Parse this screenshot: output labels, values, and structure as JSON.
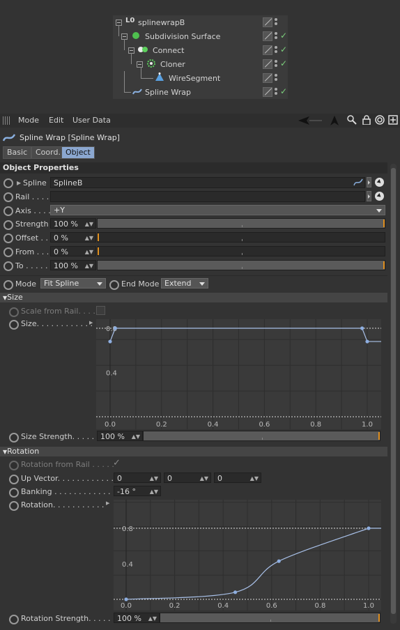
{
  "object_manager": {
    "objects": [
      {
        "name": "splinewrapB",
        "check": false
      },
      {
        "name": "Subdivision Surface",
        "check": true
      },
      {
        "name": "Connect",
        "check": true
      },
      {
        "name": "Cloner",
        "check": true
      },
      {
        "name": "WireSegment",
        "check": false
      },
      {
        "name": "Spline Wrap",
        "check": true
      }
    ]
  },
  "menubar": {
    "mode": "Mode",
    "edit": "Edit",
    "user_data": "User Data"
  },
  "title": "Spline Wrap [Spline Wrap]",
  "tabs": {
    "basic": "Basic",
    "coord": "Coord.",
    "object": "Object"
  },
  "object_properties": {
    "header": "Object Properties",
    "spline": {
      "label": "Spline",
      "value": "SplineB"
    },
    "rail": {
      "label": "Rail . . . .",
      "value": ""
    },
    "axis": {
      "label": "Axis . . . .",
      "value": "+Y"
    },
    "strength": {
      "label": "Strength",
      "value": "100 %",
      "level": 1.0
    },
    "offset": {
      "label": "Offset . .",
      "value": "0 %",
      "level": 0.0
    },
    "from": {
      "label": "From . . .",
      "value": "0 %",
      "level": 0.0
    },
    "to": {
      "label": "To . . . . .",
      "value": "100 %",
      "level": 1.0
    },
    "mode": {
      "label": "Mode",
      "value": "Fit Spline"
    },
    "end_mode": {
      "label": "End Mode",
      "value": "Extend"
    }
  },
  "size": {
    "header": "Size",
    "scale_from_rail": "Scale from Rail. . . . .",
    "size_label": "Size. . . . . . . . . . . .",
    "size_strength": {
      "label": "Size Strength. . . . . .",
      "value": "100 %",
      "level": 1.0
    },
    "graph": {
      "x_ticks": [
        "0.0",
        "0.2",
        "0.4",
        "0.6",
        "0.8",
        "1.0"
      ],
      "y_ticks": [
        "0.4",
        "0.8"
      ],
      "points": [
        [
          0.0,
          0.68
        ],
        [
          0.02,
          0.8
        ],
        [
          0.98,
          0.8
        ],
        [
          1.0,
          0.68
        ]
      ]
    }
  },
  "rotation": {
    "header": "Rotation",
    "rotation_from_rail": "Rotation from Rail . . . . .",
    "up_vector": {
      "label": "Up Vector. . . . . . . . . . . . .",
      "values": [
        "0",
        "0",
        "0"
      ]
    },
    "banking": {
      "label": "Banking . . . . . . . . . . . . . .",
      "value": "-16 °"
    },
    "rotation_label": "Rotation. . . . . . . . . . .",
    "rotation_strength": {
      "label": "Rotation Strength. . . . .",
      "value": "100 %",
      "level": 1.0
    },
    "graph": {
      "x_ticks": [
        "0.0",
        "0.2",
        "0.4",
        "0.6",
        "0.8",
        "1.0"
      ],
      "y_ticks": [
        "0.4",
        "0.8"
      ],
      "points": [
        [
          0.0,
          0.0
        ],
        [
          0.45,
          0.08
        ],
        [
          0.63,
          0.43
        ],
        [
          1.0,
          0.8
        ]
      ]
    }
  },
  "colors": {
    "accent": "#8ba7d0",
    "marker": "#e09020",
    "curve": "#a8c0e8"
  }
}
